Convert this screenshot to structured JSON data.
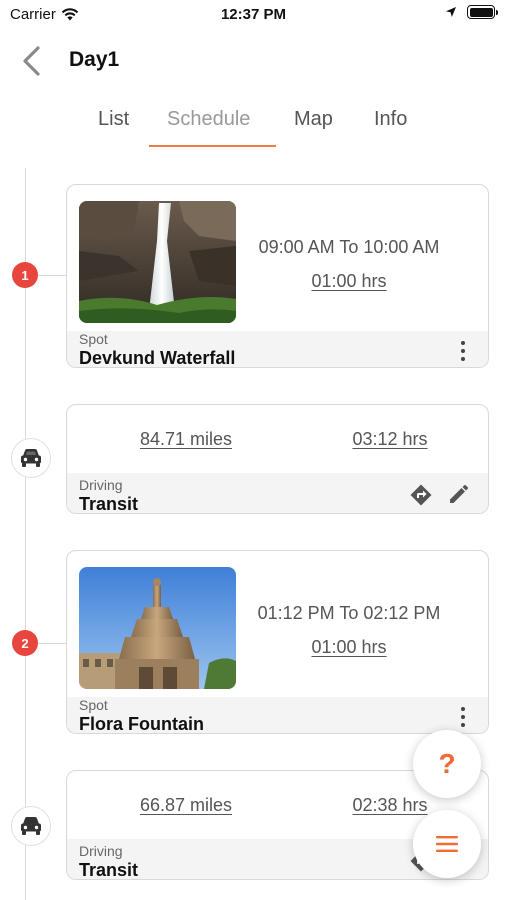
{
  "status_bar": {
    "carrier": "Carrier",
    "time": "12:37 PM"
  },
  "header": {
    "title": "Day1",
    "back_icon": "chevron-left-icon"
  },
  "tabs": [
    {
      "label": "List",
      "active": false
    },
    {
      "label": "Schedule",
      "active": true
    },
    {
      "label": "Map",
      "active": false
    },
    {
      "label": "Info",
      "active": false
    }
  ],
  "items": [
    {
      "type": "spot",
      "marker": "1",
      "time_range": "09:00 AM To 10:00 AM",
      "duration": "01:00 hrs",
      "kind": "Spot",
      "name": "Devkund Waterfall"
    },
    {
      "type": "drive",
      "distance": "84.71 miles",
      "drive_time": "03:12 hrs",
      "kind": "Driving",
      "name": "Transit"
    },
    {
      "type": "spot",
      "marker": "2",
      "time_range": "01:12 PM To 02:12 PM",
      "duration": "01:00 hrs",
      "kind": "Spot",
      "name": "Flora Fountain"
    },
    {
      "type": "drive",
      "distance": "66.87 miles",
      "drive_time": "02:38 hrs",
      "kind": "Driving",
      "name": "Transit"
    }
  ],
  "fabs": {
    "help_label": "?",
    "menu_icon": "menu-icon"
  },
  "colors": {
    "accent": "#f06a35",
    "marker_red": "#e8453c",
    "tab_underline": "#f07a4a"
  }
}
